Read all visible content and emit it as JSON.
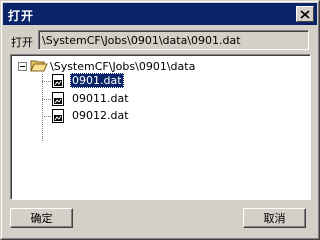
{
  "dialog": {
    "title": "打开",
    "close_icon": "close-icon"
  },
  "path": {
    "label": "打开",
    "value": "\\SystemCF\\Jobs\\0901\\data\\0901.dat"
  },
  "tree": {
    "root": {
      "label": "\\SystemCF\\Jobs\\0901\\data",
      "icon": "folder-open-icon",
      "expanded": true
    },
    "files": [
      {
        "label": "0901.dat",
        "icon": "data-file-icon",
        "selected": true
      },
      {
        "label": "09011.dat",
        "icon": "data-file-icon",
        "selected": false
      },
      {
        "label": "09012.dat",
        "icon": "data-file-icon",
        "selected": false
      }
    ]
  },
  "buttons": {
    "ok_label": "确定",
    "cancel_label": "取消"
  },
  "colors": {
    "titlebar": "#0a246a",
    "face": "#d4d0c8",
    "selection": "#0a246a"
  }
}
